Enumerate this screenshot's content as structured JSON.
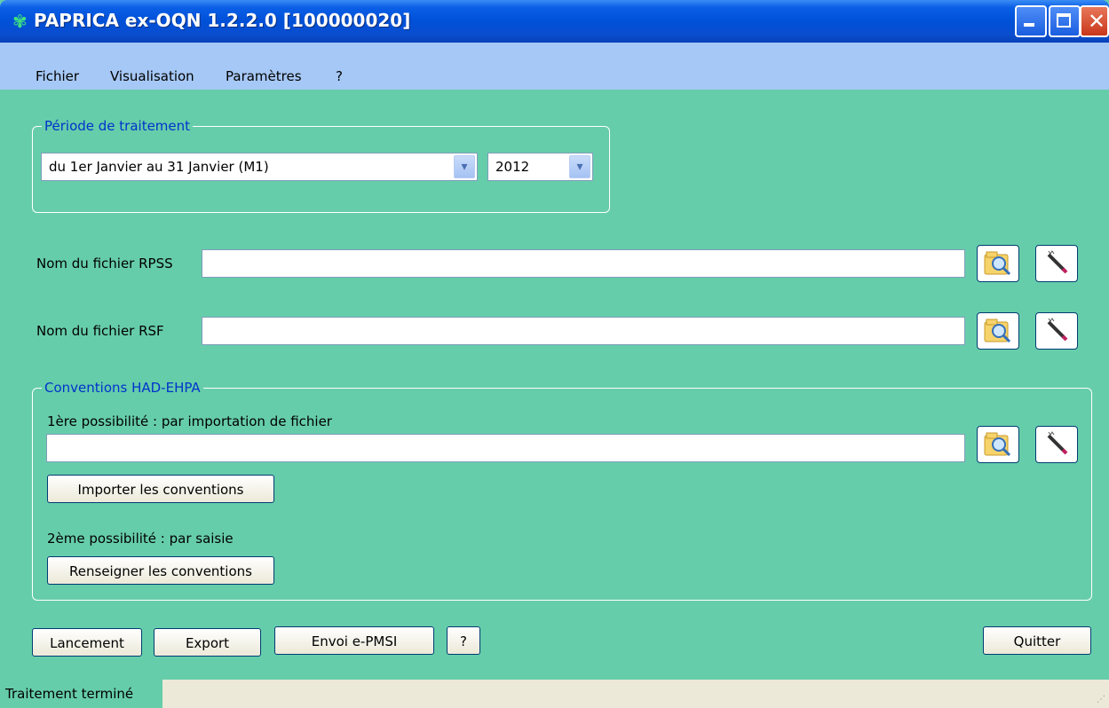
{
  "window": {
    "title": "PAPRICA ex-OQN 1.2.2.0 [100000020]",
    "app_icon": "paprica-logo-icon"
  },
  "menu": [
    "Fichier",
    "Visualisation",
    "Paramètres",
    "?"
  ],
  "periode": {
    "legend": "Période de traitement",
    "period_value": "du 1er Janvier au 31 Janvier (M1)",
    "year_value": "2012"
  },
  "rpss": {
    "label": "Nom du fichier RPSS",
    "value": ""
  },
  "rsf": {
    "label": "Nom du fichier RSF",
    "value": ""
  },
  "conventions": {
    "legend": "Conventions HAD-EHPA",
    "option1_label": "1ère possibilité : par importation de fichier",
    "file_value": "",
    "import_button": "Importer les conventions",
    "option2_label": "2ème possibilité : par saisie",
    "fill_button": "Renseigner les conventions"
  },
  "actions": {
    "launch": "Lancement",
    "export": "Export",
    "send": "Envoi e-PMSI",
    "help": "?",
    "quit": "Quitter"
  },
  "status": {
    "text": "Traitement terminé"
  },
  "icons": {
    "browse": "browse-folder-icon",
    "edit": "edit-pen-icon"
  },
  "colors": {
    "background": "#66cdaa",
    "titlebar": "#0050d8",
    "menubar": "#a6c8f6",
    "legend_text": "#0033cc"
  }
}
